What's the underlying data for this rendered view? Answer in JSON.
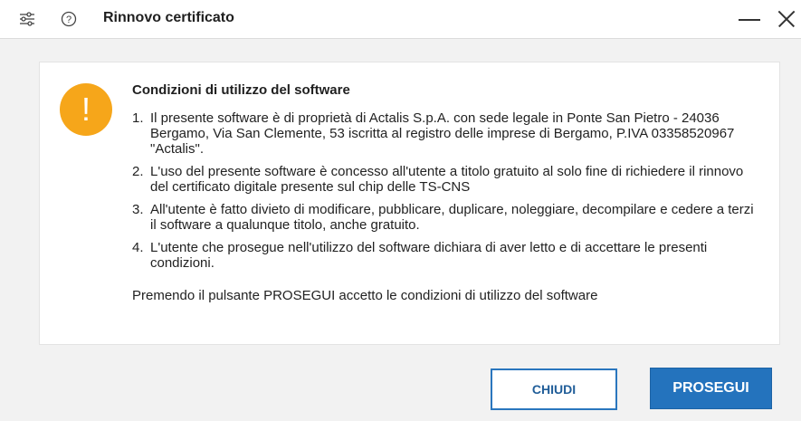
{
  "titlebar": {
    "settings_icon": "sliders-icon",
    "help_icon": "help-icon",
    "title": "Rinnovo certificato",
    "minimize_icon": "minimize-icon",
    "close_icon": "close-icon"
  },
  "dialog": {
    "icon": "warning-icon",
    "icon_glyph": "!",
    "icon_color": "#f6a61a",
    "heading": "Condizioni di utilizzo del software",
    "terms": [
      {
        "num": "1.",
        "text": "Il presente software è di proprietà di Actalis S.p.A. con sede legale in Ponte San Pietro - 24036 Bergamo, Via San Clemente, 53 iscritta al registro delle imprese di Bergamo, P.IVA 03358520967 \"Actalis\"."
      },
      {
        "num": "2.",
        "text": "L'uso del presente software è concesso all'utente a titolo gratuito al solo fine di richiedere il rinnovo del certificato digitale presente sul chip delle TS-CNS"
      },
      {
        "num": "3.",
        "text": "All'utente è fatto divieto di modificare, pubblicare, duplicare, noleggiare, decompilare e cedere a terzi il software a qualunque titolo, anche gratuito."
      },
      {
        "num": "4.",
        "text": "L'utente che prosegue nell'utilizzo del software dichiara di aver letto e di accettare le presenti condizioni."
      }
    ],
    "footer_note": "Premendo il pulsante PROSEGUI accetto le condizioni di utilizzo del software"
  },
  "buttons": {
    "close_label": "CHIUDI",
    "proceed_label": "PROSEGUI"
  },
  "colors": {
    "accent": "#2473bd",
    "warning": "#f6a61a"
  }
}
